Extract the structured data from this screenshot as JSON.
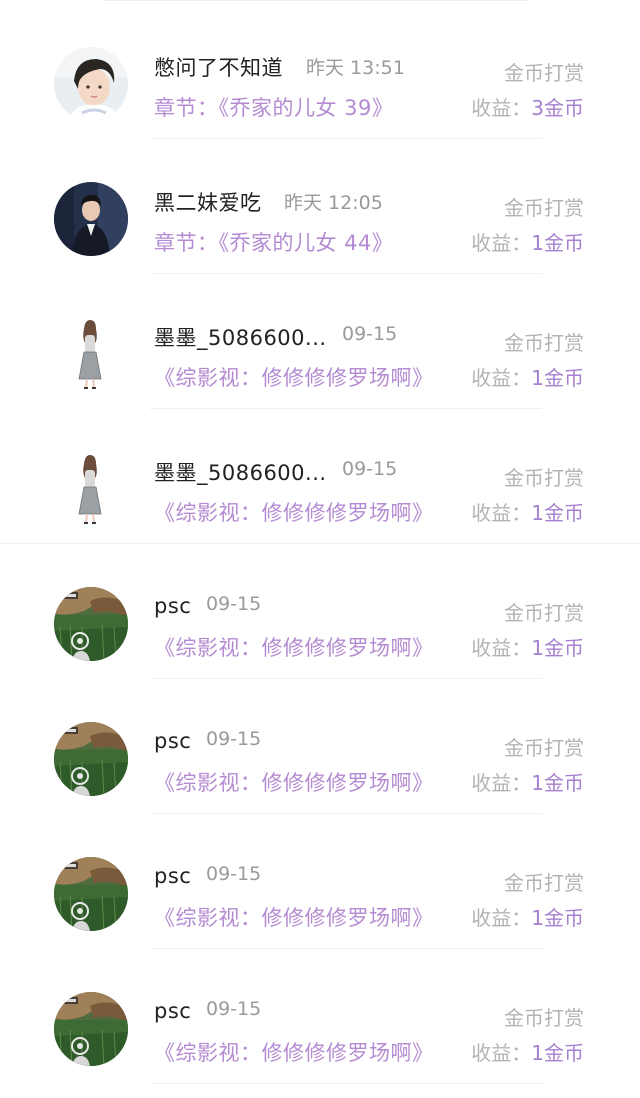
{
  "rows": [
    {
      "user": "憋问了不知道",
      "time": "昨天 13:51",
      "chapter": "章节：《乔家的儿女 39》",
      "reward_label": "金币打赏",
      "earn_label": "收益：",
      "earn_value": "3金币",
      "avatar": "boy-portrait-avatar"
    },
    {
      "user": "黑二妹爱吃",
      "time": "昨天 12:05",
      "chapter": "章节：《乔家的儿女 44》",
      "reward_label": "金币打赏",
      "earn_label": "收益：",
      "earn_value": "1金币",
      "avatar": "dark-portrait-avatar"
    },
    {
      "user": "墨墨_5086600...",
      "time": "09-15",
      "chapter": "《综影视：修修修修罗场啊》",
      "reward_label": "金币打赏",
      "earn_label": "收益：",
      "earn_value": "1金币",
      "avatar": "girl-figure-avatar"
    },
    {
      "user": "墨墨_5086600...",
      "time": "09-15",
      "chapter": "《综影视：修修修修罗场啊》",
      "reward_label": "金币打赏",
      "earn_label": "收益：",
      "earn_value": "1金币",
      "avatar": "girl-figure-avatar"
    },
    {
      "user": "psc",
      "time": "09-15",
      "chapter": "《综影视：修修修修罗场啊》",
      "reward_label": "金币打赏",
      "earn_label": "收益：",
      "earn_value": "1金币",
      "avatar": "game-screenshot-avatar"
    },
    {
      "user": "psc",
      "time": "09-15",
      "chapter": "《综影视：修修修修罗场啊》",
      "reward_label": "金币打赏",
      "earn_label": "收益：",
      "earn_value": "1金币",
      "avatar": "game-screenshot-avatar"
    },
    {
      "user": "psc",
      "time": "09-15",
      "chapter": "《综影视：修修修修罗场啊》",
      "reward_label": "金币打赏",
      "earn_label": "收益：",
      "earn_value": "1金币",
      "avatar": "game-screenshot-avatar"
    },
    {
      "user": "psc",
      "time": "09-15",
      "chapter": "《综影视：修修修修罗场啊》",
      "reward_label": "金币打赏",
      "earn_label": "收益：",
      "earn_value": "1金币",
      "avatar": "game-screenshot-avatar"
    }
  ],
  "colors": {
    "chapter": "#b48bd2",
    "earn_value": "#a67fcf",
    "muted": "#b3b3b3",
    "name": "#222222"
  }
}
